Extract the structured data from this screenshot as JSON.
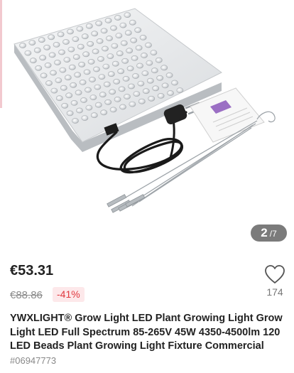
{
  "gallery": {
    "current": "2",
    "separator": "/",
    "total": "7"
  },
  "product": {
    "price": "€53.31",
    "old_price": "€88.86",
    "discount": "-41%",
    "favorites": "174",
    "title": "YWXLIGHT® Grow Light LED Plant Growing Light Grow Light LED Full Spectrum 85-265V 45W 4350-4500lm 120 LED Beads Plant Growing Light Fixture Commercial",
    "sku": "#06947773"
  },
  "icons": {
    "favorite": "heart-outline-icon"
  }
}
